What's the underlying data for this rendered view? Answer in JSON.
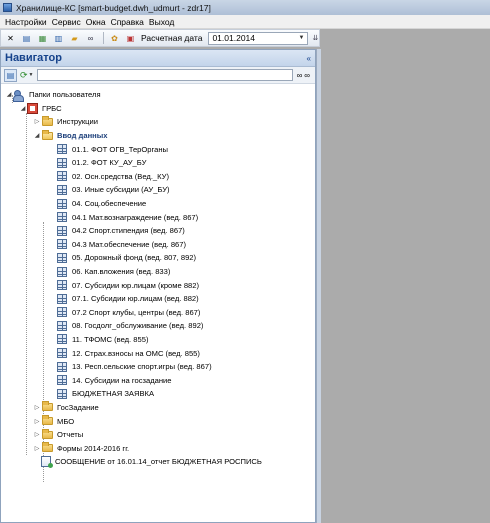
{
  "window": {
    "title": "Хранилище-КС [smart-budget.dwh_udmurt - zdr17]"
  },
  "menu": [
    "Настройки",
    "Сервис",
    "Окна",
    "Справка",
    "Выход"
  ],
  "toolbar": {
    "date_label": "Расчетная дата",
    "date_value": "01.01.2014",
    "icons": [
      "tools-icon",
      "document-icon",
      "table-icon",
      "grid-icon",
      "folder-icon",
      "binoculars-icon",
      "folder-gear-icon",
      "calendar-icon"
    ]
  },
  "navigator": {
    "title": "Навигатор",
    "search_placeholder": "",
    "tree": {
      "root": "Папки пользователя",
      "grbs": "ГРБС",
      "instructions": "Инструкции",
      "data_entry": "Ввод данных",
      "items": [
        "01.1. ФОТ ОГВ_ТерОрганы",
        "01.2. ФОТ КУ_АУ_БУ",
        "02. Осн.средства (Вед._КУ)",
        "03. Иные субсидии (АУ_БУ)",
        "04. Соц.обеспечение",
        "04.1 Мат.вознаграждение (вед. 867)",
        "04.2 Спорт.стипендия (вед. 867)",
        "04.3 Мат.обеспечение (вед. 867)",
        "05. Дорожный фонд (вед. 807, 892)",
        "06. Кап.вложения (вед. 833)",
        "07. Субсидии юр.лицам (кроме 882)",
        "07.1. Субсидии юр.лицам (вед. 882)",
        "07.2 Спорт клубы, центры (вед. 867)",
        "08. Госдолг_обслуживание (вед. 892)",
        "11. ТФОМС (вед. 855)",
        "12. Страх.взносы на ОМС (вед. 855)",
        "13. Респ.сельские спорт.игры (вед. 867)",
        "14. Субсидии на госзадание",
        "БЮДЖЕТНАЯ ЗАЯВКА"
      ],
      "gos_zadanie": "ГосЗадание",
      "mbo": "МБО",
      "reports": "Отчеты",
      "forms": "Формы 2014-2016 гг.",
      "message": "СООБЩЕНИЕ от 16.01.14_отчет БЮДЖЕТНАЯ РОСПИСЬ"
    }
  }
}
